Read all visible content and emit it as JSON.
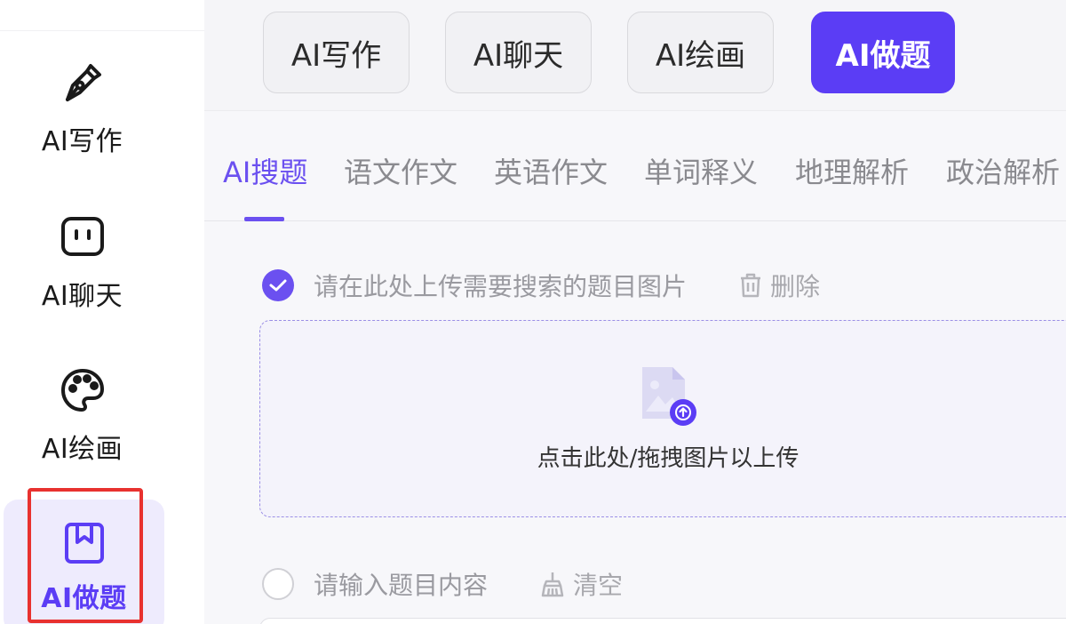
{
  "sidebar": {
    "items": [
      {
        "label": "AI写作",
        "icon": "pen-nib-icon",
        "active": false
      },
      {
        "label": "AI聊天",
        "icon": "chat-bot-icon",
        "active": false
      },
      {
        "label": "AI绘画",
        "icon": "palette-icon",
        "active": false
      },
      {
        "label": "AI做题",
        "icon": "bookmark-book-icon",
        "active": true
      }
    ]
  },
  "top_tabs": [
    {
      "label": "AI写作",
      "active": false
    },
    {
      "label": "AI聊天",
      "active": false
    },
    {
      "label": "AI绘画",
      "active": false
    },
    {
      "label": "AI做题",
      "active": true
    }
  ],
  "sub_tabs": [
    {
      "label": "AI搜题",
      "active": true
    },
    {
      "label": "语文作文",
      "active": false
    },
    {
      "label": "英语作文",
      "active": false
    },
    {
      "label": "单词释义",
      "active": false
    },
    {
      "label": "地理解析",
      "active": false
    },
    {
      "label": "政治解析",
      "active": false
    }
  ],
  "image_option": {
    "label": "请在此处上传需要搜索的题目图片",
    "checked": true,
    "delete_label": "删除"
  },
  "dropzone": {
    "text": "点击此处/拖拽图片以上传"
  },
  "text_option": {
    "label": "请输入题目内容",
    "checked": false,
    "clear_label": "清空"
  },
  "colors": {
    "accent": "#5b3df5",
    "accent_text": "#6b50f0",
    "highlight_box": "#e8312f",
    "muted_text": "#9a9aa0"
  }
}
